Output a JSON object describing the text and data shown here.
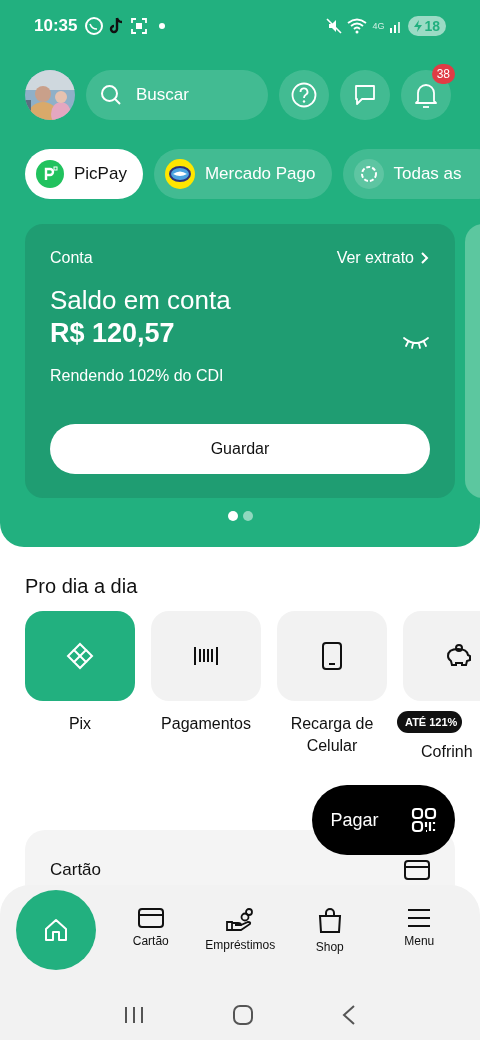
{
  "status_bar": {
    "time": "10:35",
    "network": "4G",
    "battery": "18"
  },
  "top_bar": {
    "search": {
      "placeholder": "Buscar"
    },
    "notifications": {
      "count": "38"
    }
  },
  "accounts": [
    {
      "label": "PicPay",
      "selected": true,
      "kind": "picpay"
    },
    {
      "label": "Mercado Pago",
      "selected": false,
      "kind": "mercado"
    },
    {
      "label": "Todas as",
      "selected": false,
      "kind": "all"
    }
  ],
  "account_card": {
    "section": "Conta",
    "link": "Ver extrato",
    "title": "Saldo em conta",
    "balance": "R$ 120,57",
    "yield": "Rendendo 102% do CDI",
    "button": "Guardar"
  },
  "carousel_pages": [
    {
      "selected": true
    },
    {
      "selected": false
    }
  ],
  "daily": {
    "title": "Pro dia a dia",
    "items": [
      {
        "label": "Pix",
        "kind": "pix",
        "highlighted": true
      },
      {
        "label": "Pagamentos",
        "kind": "barcode",
        "highlighted": false
      },
      {
        "label": "Recarga de Celular",
        "kind": "phone",
        "highlighted": false
      },
      {
        "label": "Cofrinh",
        "kind": "piggy",
        "highlighted": false,
        "badge": "ATÉ 121%"
      }
    ]
  },
  "pay_button": {
    "label": "Pagar"
  },
  "card_section": {
    "title": "Cartão"
  },
  "bottom_nav": [
    {
      "kind": "home",
      "selected": true
    },
    {
      "kind": "card",
      "label": "Cartão",
      "selected": false
    },
    {
      "kind": "loans",
      "label": "Empréstimos",
      "selected": false
    },
    {
      "kind": "shop",
      "label": "Shop",
      "selected": false
    },
    {
      "kind": "menu",
      "label": "Menu",
      "selected": false
    }
  ]
}
